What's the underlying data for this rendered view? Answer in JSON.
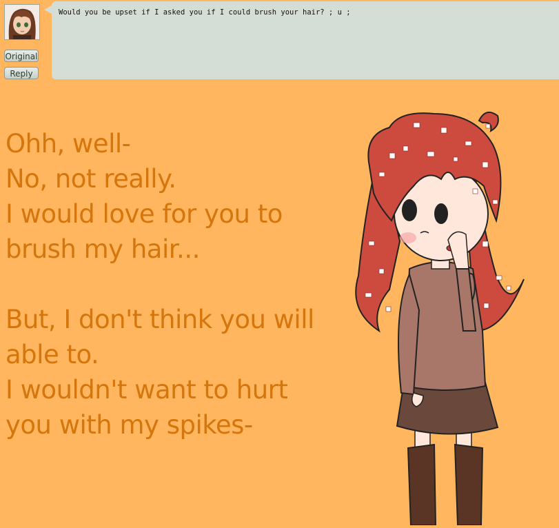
{
  "post": {
    "avatar_icon": "user-avatar-icon",
    "original_label": "Original",
    "reply_label": "Reply",
    "question": "Would you be upset if I asked you if I could brush your hair? ; u ;"
  },
  "answer": {
    "lines": [
      "Ohh, well-",
      "No, not really.",
      "I would love for you to",
      "brush my hair...",
      "",
      "But, I don't think you will",
      "able to.",
      "I wouldn't want to hurt",
      "you with my spikes-"
    ]
  },
  "colors": {
    "background": "#ffb65e",
    "bubble": "#d5ded6",
    "answer_text": "#d4760b",
    "hair": "#cc4a3e",
    "sweater": "#a8776a",
    "skirt": "#6a483c"
  }
}
